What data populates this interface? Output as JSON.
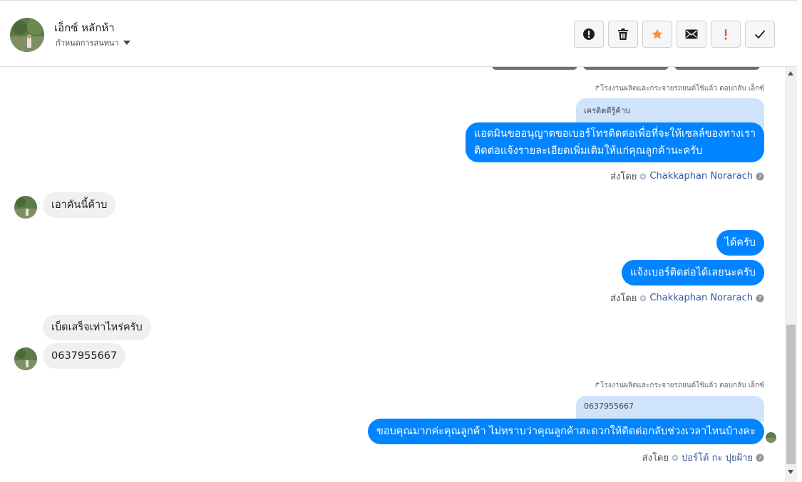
{
  "header": {
    "contact_name": "เอ็กซ์ หลักห้า",
    "assign_label": "กำหนดการสนทนา",
    "actions": [
      {
        "name": "mark-spam-button",
        "icon": "exclamation-circle-icon"
      },
      {
        "name": "delete-button",
        "icon": "trash-icon"
      },
      {
        "name": "star-button",
        "icon": "star-icon"
      },
      {
        "name": "mark-unread-button",
        "icon": "envelope-icon"
      },
      {
        "name": "follow-up-button",
        "icon": "exclamation-icon"
      },
      {
        "name": "mark-done-button",
        "icon": "checkmark-icon"
      }
    ]
  },
  "thread": {
    "reply_note_1": "โรงงานผลิตและกระจายรถยนต์ใช้แล้ว ตอบกลับ เอ็กซ์",
    "quoted_1": "เครดิตดีรู้ค้าบ",
    "out_1_line1": "แอดมินขออนุญาตขอเบอร์โทรติดต่อเพื่อที่จะให้เซลล์ของทางเรา",
    "out_1_line2": "ติดต่อแจ้งรายละเอียดเพิ่มเติมให้แก่คุณลูกค้านะครับ",
    "sent_by_label": "ส่งโดย",
    "sender_1": "Chakkaphan Norarach",
    "in_1": "เอาคันนี้ค้าบ",
    "out_2": "ได้ครับ",
    "out_3": "แจ้งเบอร์ติดต่อได้เลยนะครับ",
    "sender_2": "Chakkaphan Norarach",
    "in_2": "เบ็ดเสร็จเท่าไหร่ครับ",
    "in_3": "0637955667",
    "reply_note_2": "โรงงานผลิตและกระจายรถยนต์ใช้แล้ว ตอบกลับ เอ็กซ์",
    "quoted_2": "0637955667",
    "out_4": "ขอบคุณมากค่ะคุณลูกค้า ไม่ทราบว่าคุณลูกค้าสะดวกให้ติดต่อกลับช่วงเวลาไหนบ้างคะ",
    "sender_3": "ปอร์โต้ กะ ปุยฝ้าย"
  },
  "colors": {
    "outgoing_bubble": "#0084ff",
    "incoming_bubble": "#f1f0f0",
    "quoted_bubble": "#cfe3fb",
    "star": "#f7923b",
    "follow_up": "#e4572e",
    "sender_name": "#365899"
  }
}
